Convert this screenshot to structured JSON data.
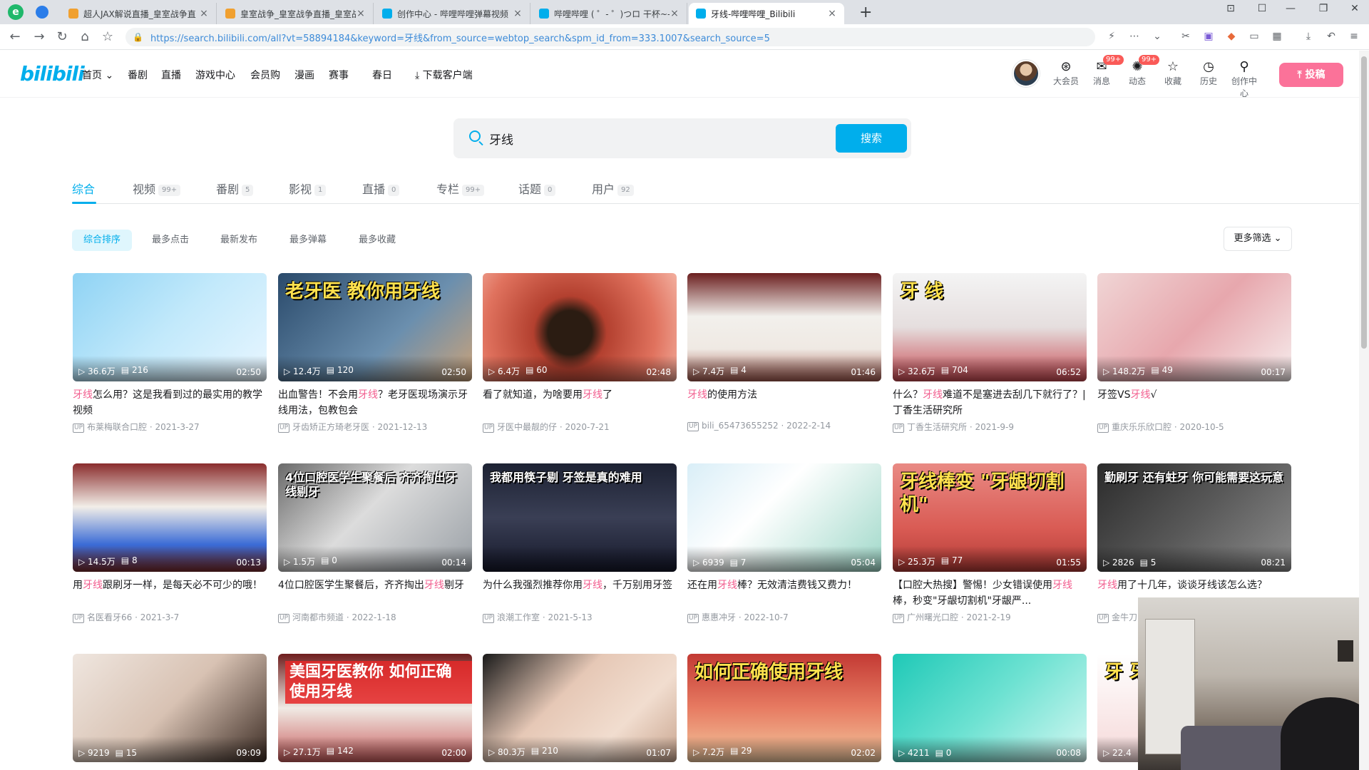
{
  "browser": {
    "tabs": [
      {
        "title": "超人JAX解说直播_皇室战争直",
        "fav": "#f0a030"
      },
      {
        "title": "皇室战争_皇室战争直播_皇室战",
        "fav": "#f0a030"
      },
      {
        "title": "创作中心 - 哔哩哔哩弹幕视频",
        "fav": "#00aeec"
      },
      {
        "title": "哔哩哔哩 ( ゜- ゜)つロ 干杯~-b",
        "fav": "#00aeec"
      },
      {
        "title": "牙线-哔哩哔哩_Bilibili",
        "fav": "#00aeec"
      }
    ],
    "url": "https://search.bilibili.com/all?vt=58894184&keyword=牙线&from_source=webtop_search&spm_id_from=333.1007&search_source=5"
  },
  "header": {
    "logo": "bilibili",
    "nav": [
      "首页",
      "番剧",
      "直播",
      "游戏中心",
      "会员购",
      "漫画",
      "赛事",
      "春日",
      "下载客户端"
    ],
    "right": [
      {
        "label": "大会员",
        "icon": "vip-icon",
        "glyph": "⊛",
        "badge": ""
      },
      {
        "label": "消息",
        "icon": "message-icon",
        "glyph": "✉",
        "badge": "99+"
      },
      {
        "label": "动态",
        "icon": "dynamic-icon",
        "glyph": "✺",
        "badge": "99+"
      },
      {
        "label": "收藏",
        "icon": "star-icon",
        "glyph": "☆",
        "badge": ""
      },
      {
        "label": "历史",
        "icon": "history-icon",
        "glyph": "◷",
        "badge": ""
      },
      {
        "label": "创作中心",
        "icon": "bulb-icon",
        "glyph": "⚲",
        "badge": ""
      }
    ],
    "upload_label": "投稿"
  },
  "search": {
    "value": "牙线",
    "button": "搜索"
  },
  "category_tabs": [
    {
      "label": "综合",
      "count": ""
    },
    {
      "label": "视频",
      "count": "99+"
    },
    {
      "label": "番剧",
      "count": "5"
    },
    {
      "label": "影视",
      "count": "1"
    },
    {
      "label": "直播",
      "count": "0"
    },
    {
      "label": "专栏",
      "count": "99+"
    },
    {
      "label": "话题",
      "count": "0"
    },
    {
      "label": "用户",
      "count": "92"
    }
  ],
  "sort": {
    "options": [
      "综合排序",
      "最多点击",
      "最新发布",
      "最多弹幕",
      "最多收藏"
    ],
    "more_filter": "更多筛选"
  },
  "videos": [
    {
      "views": "36.6万",
      "danmaku": "216",
      "duration": "02:50",
      "title_pre": "",
      "title_hl": "牙线",
      "title_post": "怎么用？这是我看到过的最实用的教学视频",
      "up": "布莱梅联合口腔",
      "date": "2021-3-27",
      "overlay": "",
      "bg": "linear-gradient(135deg,#8fd3f4 0%,#c2e9fb 50%,#e8f6ff 100%)"
    },
    {
      "views": "12.4万",
      "danmaku": "120",
      "duration": "02:50",
      "title_pre": "出血警告！不会用",
      "title_hl": "牙线",
      "title_post": "？老牙医现场演示牙线用法，包教包会",
      "up": "牙齿矫正方琦老牙医",
      "date": "2021-12-13",
      "overlay": "老牙医 教你用牙线",
      "bg": "linear-gradient(135deg,#2a4a6b 0%,#6b8fae 60%,#c9a27a 100%)"
    },
    {
      "views": "6.4万",
      "danmaku": "60",
      "duration": "02:48",
      "title_pre": "看了就知道，为啥要用",
      "title_hl": "牙线",
      "title_post": "了",
      "up": "牙医中最靓的仔",
      "date": "2020-7-21",
      "overlay": "",
      "bg": "radial-gradient(circle at 45% 55%,#2b1c12 0 18%,#b3402f 30%,#e0725e 70%,#f3b0a0 100%)"
    },
    {
      "views": "7.4万",
      "danmaku": "4",
      "duration": "01:46",
      "title_pre": "",
      "title_hl": "牙线",
      "title_post": "的使用方法",
      "up": "bili_65473655252",
      "date": "2022-2-14",
      "overlay": "",
      "bg": "linear-gradient(180deg,#6b1f1f 0%,#f2f0ec 40%,#efe9e3 70%,#a35a4f 100%)"
    },
    {
      "views": "32.6万",
      "danmaku": "704",
      "duration": "06:52",
      "title_pre": "什么？",
      "title_hl": "牙线",
      "title_post": "难道不是塞进去刮几下就行了？| 丁香生活研究所",
      "up": "丁香生活研究所",
      "date": "2021-9-9",
      "overlay": "牙      线",
      "bg": "linear-gradient(180deg,#f4f4f4 0%,#e5dede 50%,#c94a52 100%)"
    },
    {
      "views": "148.2万",
      "danmaku": "49",
      "duration": "00:17",
      "title_pre": "牙签VS",
      "title_hl": "牙线",
      "title_post": "√",
      "up": "重庆乐乐欣口腔",
      "date": "2020-10-5",
      "overlay": "",
      "bg": "linear-gradient(135deg,#f0d5d5 0%,#e7a7ad 50%,#f6ecec 100%)"
    },
    {
      "views": "14.5万",
      "danmaku": "8",
      "duration": "00:13",
      "title_pre": "用",
      "title_hl": "牙线",
      "title_post": "跟刷牙一样，是每天必不可少的哦！",
      "up": "名医看牙66",
      "date": "2021-3-7",
      "overlay": "",
      "bg": "linear-gradient(180deg,#8a2d2d 0%,#f2eee8 40%,#3a6bd6 75%,#7b2b2b 100%)"
    },
    {
      "views": "1.5万",
      "danmaku": "0",
      "duration": "00:14",
      "title_pre": "4位口腔医学生聚餐后，齐齐掏出",
      "title_hl": "牙线",
      "title_post": "剔牙",
      "up": "河南都市频道",
      "date": "2022-1-18",
      "overlay": "4位口腔医学生聚餐后 齐齐掏出牙线剔牙",
      "bg": "linear-gradient(135deg,#6a6a6a 0%,#dcdcdc 45%,#9aa0a6 100%)"
    },
    {
      "views": "",
      "danmaku": "",
      "duration": "",
      "title_pre": "为什么我强烈推荐你用",
      "title_hl": "牙线",
      "title_post": "，千万别用牙签",
      "up": "浪潮工作室",
      "date": "2021-5-13",
      "overlay": "我都用筷子剔 牙签是真的难用",
      "bg": "linear-gradient(180deg,#1d2233 0%,#3a3f55 50%,#15182a 100%)"
    },
    {
      "views": "6939",
      "danmaku": "7",
      "duration": "05:04",
      "title_pre": "还在用",
      "title_hl": "牙线",
      "title_post": "棒？无效清洁费钱又费力！",
      "up": "惠惠冲牙",
      "date": "2022-10-7",
      "overlay": "",
      "bg": "linear-gradient(135deg,#d9eef7 0%,#ffffff 40%,#9fd8c9 100%)"
    },
    {
      "views": "25.3万",
      "danmaku": "77",
      "duration": "01:55",
      "title_pre": "【口腔大热搜】警惕！少女错误使用",
      "title_hl": "牙线",
      "title_post": "棒，秒变\"牙龈切割机\"牙龈严...",
      "up": "广州曙光口腔",
      "date": "2021-2-19",
      "overlay": "牙线棒变 \"牙龈切割机\"",
      "bg": "linear-gradient(180deg,#e98a84 0%,#d95b54 60%,#b23b36 100%)"
    },
    {
      "views": "2826",
      "danmaku": "5",
      "duration": "08:21",
      "title_pre": "",
      "title_hl": "牙线",
      "title_post": "用了十几年，谈谈牙线该怎么选？",
      "up": "金牛刀",
      "date": "",
      "overlay": "勤刷牙 还有蛀牙 你可能需要这玩意",
      "bg": "linear-gradient(135deg,#2b2b2b 0%,#585858 50%,#8c8c8c 100%)"
    },
    {
      "views": "9219",
      "danmaku": "15",
      "duration": "09:09",
      "title_pre": "",
      "title_hl": "",
      "title_post": "",
      "up": "",
      "date": "",
      "overlay": "",
      "bg": "linear-gradient(135deg,#efe6df 0%,#d8c2b3 50%,#3a2a22 100%)"
    },
    {
      "views": "27.1万",
      "danmaku": "142",
      "duration": "02:00",
      "title_pre": "",
      "title_hl": "",
      "title_post": "",
      "up": "",
      "date": "",
      "overlay": "美国牙医教你 如何正确 使用牙线",
      "bg": "linear-gradient(180deg,#6e1d1d 0%,#f0ebe5 50%,#c95c5c 100%)"
    },
    {
      "views": "80.3万",
      "danmaku": "210",
      "duration": "01:07",
      "title_pre": "",
      "title_hl": "",
      "title_post": "",
      "up": "",
      "date": "",
      "overlay": "",
      "bg": "linear-gradient(135deg,#1a1a1a 0%,#e6c8b6 40%,#f1ddcf 70%,#c9a58f 100%)"
    },
    {
      "views": "7.2万",
      "danmaku": "29",
      "duration": "02:02",
      "title_pre": "",
      "title_hl": "",
      "title_post": "",
      "up": "",
      "date": "",
      "overlay": "如何正确使用牙线",
      "bg": "linear-gradient(180deg,#c33a34 0%,#e77b62 50%,#f3c99f 100%)"
    },
    {
      "views": "4211",
      "danmaku": "0",
      "duration": "00:08",
      "title_pre": "",
      "title_hl": "",
      "title_post": "",
      "up": "",
      "date": "",
      "overlay": "",
      "bg": "linear-gradient(135deg,#1fc9b7 0%,#6ee2d2 50%,#d4f7f2 100%)"
    },
    {
      "views": "22.4",
      "danmaku": "",
      "duration": "",
      "title_pre": "",
      "title_hl": "",
      "title_post": "",
      "up": "",
      "date": "",
      "overlay": "牙 牙",
      "bg": "linear-gradient(180deg,#ffffff 0%,#f5d8d8 100%)"
    }
  ]
}
